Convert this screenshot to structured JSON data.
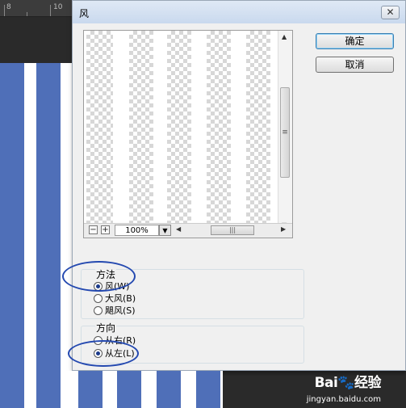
{
  "background": {
    "ruler_numbers": [
      "8",
      "10"
    ],
    "stripe_color": "#4f6fb8"
  },
  "dialog": {
    "title": "风",
    "close_glyph": "✕",
    "ok_label": "确定",
    "cancel_label": "取消"
  },
  "preview": {
    "zoom_value": "100%",
    "minus_glyph": "−",
    "plus_glyph": "+",
    "dropdown_glyph": "▼",
    "scroll_up": "▲",
    "scroll_down": "▼",
    "scroll_left": "◀",
    "scroll_right": "▶",
    "thumb_grip": "|||"
  },
  "method_group": {
    "label": "方法",
    "options": [
      {
        "label": "风(W)",
        "selected": true
      },
      {
        "label": "大风(B)",
        "selected": false
      },
      {
        "label": "飓风(S)",
        "selected": false
      }
    ]
  },
  "direction_group": {
    "label": "方向",
    "options": [
      {
        "label": "从右(R)",
        "selected": false
      },
      {
        "label": "从左(L)",
        "selected": true
      }
    ]
  },
  "annotation_color": "#2449b0",
  "watermark": {
    "logo": "Bai🐾经验",
    "url": "jingyan.baidu.com"
  }
}
